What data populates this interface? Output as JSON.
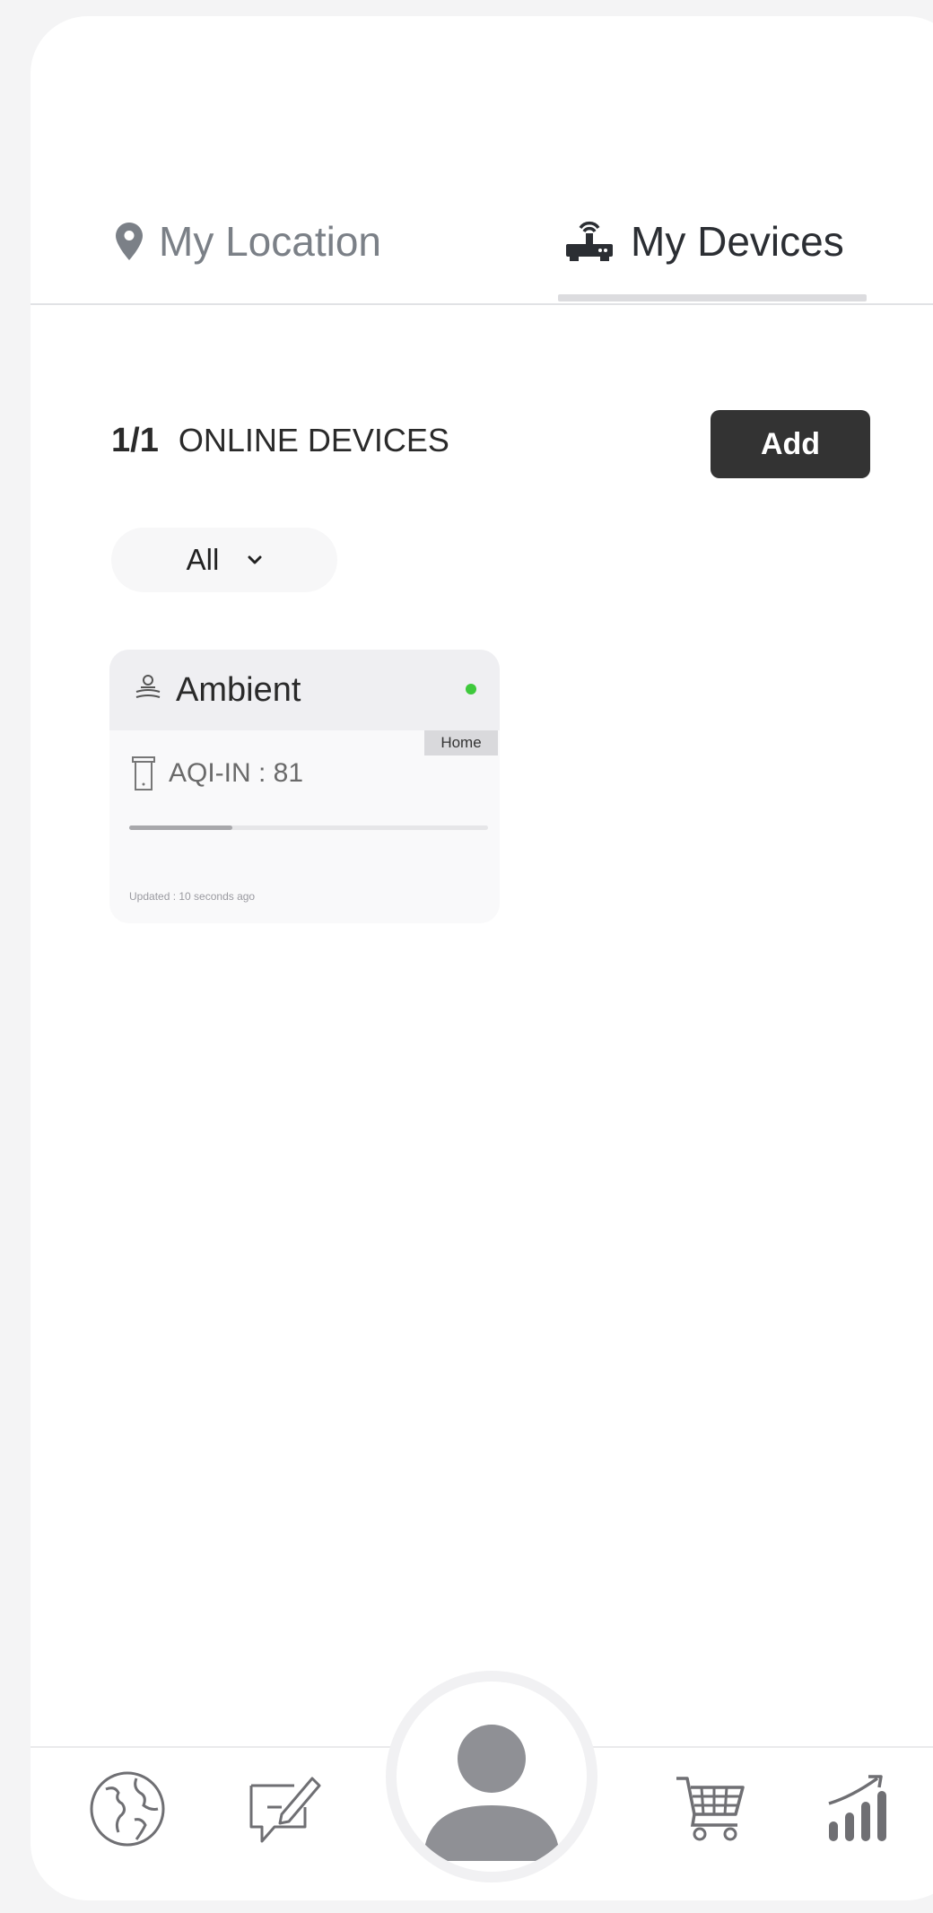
{
  "tabs": {
    "location_label": "My Location",
    "devices_label": "My Devices",
    "active": "devices"
  },
  "devices_header": {
    "count": "1/1",
    "label": "ONLINE DEVICES",
    "add_label": "Add"
  },
  "filter": {
    "selected": "All"
  },
  "device_card": {
    "name": "Ambient",
    "status": "online",
    "status_color": "#3ec93c",
    "tag": "Home",
    "reading": "AQI-IN : 81",
    "aqi_value": 81,
    "updated": "Updated : 10 seconds ago"
  },
  "bottom_nav": {
    "items": [
      "globe-icon",
      "feedback-icon",
      "profile-avatar",
      "cart-icon",
      "stats-icon"
    ]
  },
  "colors": {
    "add_button_bg": "#333333",
    "active_tab_text": "#2b2e33",
    "inactive_tab_text": "#7b8087",
    "online_dot": "#3ec93c"
  }
}
